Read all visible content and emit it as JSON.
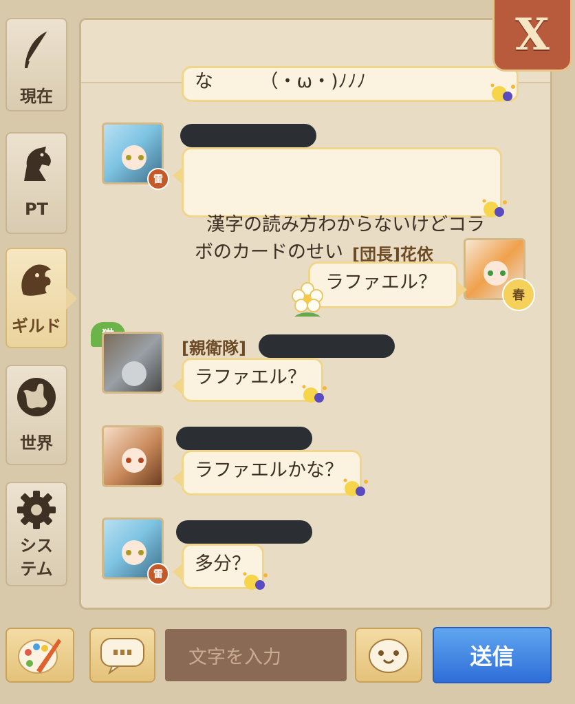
{
  "window": {
    "close_label": "X"
  },
  "side_tabs": [
    {
      "label": "現在",
      "icon": "quill-icon"
    },
    {
      "label": "PT",
      "icon": "horse-head-icon"
    },
    {
      "label": "ギルド",
      "icon": "lion-crest-icon"
    },
    {
      "label": "世界",
      "icon": "globe-icon"
    },
    {
      "label": "シス\nテム",
      "icon": "gear-icon"
    }
  ],
  "messages": [
    {
      "text": "な　　　（・ω・)ﾉﾉﾉ",
      "side": "left",
      "partial": true
    },
    {
      "text": "漢字の読み方わからないけどコラ\nボのカードのせい",
      "side": "left",
      "badge": "雷"
    },
    {
      "name": "[団長]花依",
      "text": "ラファエル？",
      "side": "right",
      "badge": "春"
    },
    {
      "name": "[親衛隊]",
      "text": "ラファエル？",
      "side": "left",
      "tag": "猫"
    },
    {
      "text": "ラファエルかな？",
      "side": "left"
    },
    {
      "text": "多分？",
      "side": "left",
      "badge": "雷"
    }
  ],
  "composer": {
    "placeholder": "文字を入力",
    "send_label": "送信"
  },
  "colors": {
    "accent_blue": "#3a7be0",
    "close_red": "#b85b3d",
    "bubble_border": "#f0d58a"
  }
}
